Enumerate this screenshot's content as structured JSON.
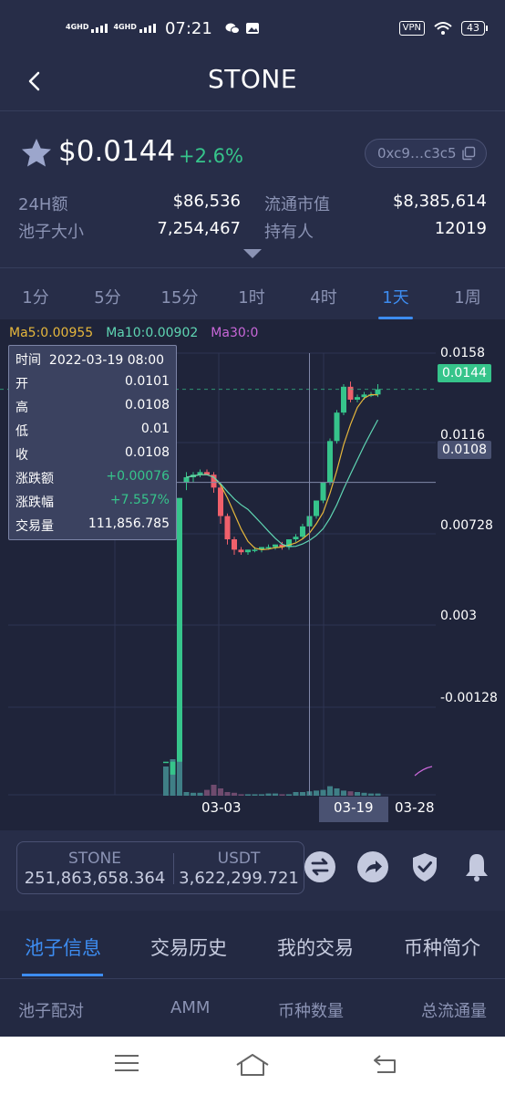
{
  "status_bar": {
    "network_1": "4GHD",
    "network_2": "4GHD",
    "time": "07:21",
    "vpn": "VPN",
    "battery": "43"
  },
  "header": {
    "title": "STONE"
  },
  "price": {
    "value": "$0.0144",
    "change": "+2.6%",
    "address": "0xc9…c3c5"
  },
  "stats": [
    {
      "label": "24H额",
      "value": "$86,536"
    },
    {
      "label": "流通市值",
      "value": "$8,385,614"
    },
    {
      "label": "池子大小",
      "value": "7,254,467"
    },
    {
      "label": "持有人",
      "value": "12019"
    }
  ],
  "timeframes": [
    "1分",
    "5分",
    "15分",
    "1时",
    "4时",
    "1天",
    "1周"
  ],
  "active_timeframe": "1天",
  "ma": {
    "ma5": "Ma5:0.00955",
    "ma10": "Ma10:0.00902",
    "ma30": "Ma30:0"
  },
  "tooltip": {
    "time_label": "时间",
    "time": "2022-03-19 08:00",
    "rows": [
      {
        "label": "开",
        "value": "0.0101"
      },
      {
        "label": "高",
        "value": "0.0108"
      },
      {
        "label": "低",
        "value": "0.01"
      },
      {
        "label": "收",
        "value": "0.0108"
      },
      {
        "label": "涨跌额",
        "value": "+0.00076"
      },
      {
        "label": "涨跌幅",
        "value": "+7.557%"
      },
      {
        "label": "交易量",
        "value": "111,856.785"
      }
    ]
  },
  "colors": {
    "up": "#36c48b",
    "down": "#f0606b",
    "accent": "#3d8cf0",
    "background": "#272d48",
    "chart_bg": "#1f243a"
  },
  "chart_data": {
    "type": "candlestick",
    "y_axis": [
      "0.0158",
      "0.0116",
      "0.00728",
      "0.003",
      "-0.00128"
    ],
    "ylim": [
      -0.00128,
      0.0158
    ],
    "x_axis": [
      "03-03",
      "03-19",
      "03-28"
    ],
    "current_price": "0.0144",
    "crosshair_price": "0.0108",
    "crosshair_date": "03-19",
    "candles": [
      {
        "o": 0.0,
        "h": 0.0,
        "l": 0.0,
        "c": 0.0
      },
      {
        "o": -0.0005,
        "h": 0.0,
        "l": -0.0005,
        "c": 0.0
      },
      {
        "o": 0.0,
        "h": 0.0102,
        "l": 0.0,
        "c": 0.0102
      },
      {
        "o": 0.0108,
        "h": 0.0112,
        "l": 0.0105,
        "c": 0.011
      },
      {
        "o": 0.011,
        "h": 0.0112,
        "l": 0.0108,
        "c": 0.0111
      },
      {
        "o": 0.0111,
        "h": 0.0113,
        "l": 0.011,
        "c": 0.0112
      },
      {
        "o": 0.0112,
        "h": 0.0113,
        "l": 0.0111,
        "c": 0.0111
      },
      {
        "o": 0.0111,
        "h": 0.0112,
        "l": 0.0104,
        "c": 0.0106
      },
      {
        "o": 0.0106,
        "h": 0.0107,
        "l": 0.0092,
        "c": 0.0095
      },
      {
        "o": 0.0095,
        "h": 0.0096,
        "l": 0.0084,
        "c": 0.0086
      },
      {
        "o": 0.0086,
        "h": 0.0087,
        "l": 0.008,
        "c": 0.0082
      },
      {
        "o": 0.0082,
        "h": 0.0083,
        "l": 0.008,
        "c": 0.0081
      },
      {
        "o": 0.0081,
        "h": 0.0082,
        "l": 0.008,
        "c": 0.0082
      },
      {
        "o": 0.0082,
        "h": 0.0083,
        "l": 0.0081,
        "c": 0.0082
      },
      {
        "o": 0.0082,
        "h": 0.0083,
        "l": 0.0081,
        "c": 0.0083
      },
      {
        "o": 0.0083,
        "h": 0.0084,
        "l": 0.0082,
        "c": 0.0083
      },
      {
        "o": 0.0083,
        "h": 0.0084,
        "l": 0.0082,
        "c": 0.0084
      },
      {
        "o": 0.0084,
        "h": 0.0085,
        "l": 0.0082,
        "c": 0.0083
      },
      {
        "o": 0.0083,
        "h": 0.0086,
        "l": 0.0082,
        "c": 0.0086
      },
      {
        "o": 0.0086,
        "h": 0.0088,
        "l": 0.0085,
        "c": 0.0087
      },
      {
        "o": 0.0087,
        "h": 0.0092,
        "l": 0.0086,
        "c": 0.0091
      },
      {
        "o": 0.0091,
        "h": 0.0096,
        "l": 0.009,
        "c": 0.0095
      },
      {
        "o": 0.0095,
        "h": 0.0101,
        "l": 0.0094,
        "c": 0.0101
      },
      {
        "o": 0.0101,
        "h": 0.0108,
        "l": 0.01,
        "c": 0.0108
      },
      {
        "o": 0.0108,
        "h": 0.0125,
        "l": 0.0107,
        "c": 0.0124
      },
      {
        "o": 0.0124,
        "h": 0.0136,
        "l": 0.0123,
        "c": 0.0135
      },
      {
        "o": 0.0135,
        "h": 0.0146,
        "l": 0.0134,
        "c": 0.0145
      },
      {
        "o": 0.0145,
        "h": 0.0147,
        "l": 0.0139,
        "c": 0.014
      },
      {
        "o": 0.014,
        "h": 0.0142,
        "l": 0.0139,
        "c": 0.0141
      },
      {
        "o": 0.0141,
        "h": 0.0143,
        "l": 0.014,
        "c": 0.0142
      },
      {
        "o": 0.0142,
        "h": 0.0143,
        "l": 0.0141,
        "c": 0.0142
      },
      {
        "o": 0.0142,
        "h": 0.0146,
        "l": 0.0141,
        "c": 0.0144
      }
    ],
    "volumes": [
      0.4,
      0.5,
      1.0,
      0.05,
      0.04,
      0.04,
      0.08,
      0.15,
      0.1,
      0.05,
      0.04,
      0.02,
      0.02,
      0.02,
      0.02,
      0.03,
      0.03,
      0.02,
      0.02,
      0.05,
      0.05,
      0.06,
      0.07,
      0.08,
      0.13,
      0.1,
      0.07,
      0.06,
      0.05,
      0.04,
      0.03,
      0.03
    ]
  },
  "swap": {
    "token_a": "STONE",
    "amount_a": "251,863,658.364",
    "token_b": "USDT",
    "amount_b": "3,622,299.721"
  },
  "lower_tabs": [
    "池子信息",
    "交易历史",
    "我的交易",
    "币种简介"
  ],
  "table_headers": [
    "池子配对",
    "AMM",
    "币种数量",
    "总流通量"
  ]
}
